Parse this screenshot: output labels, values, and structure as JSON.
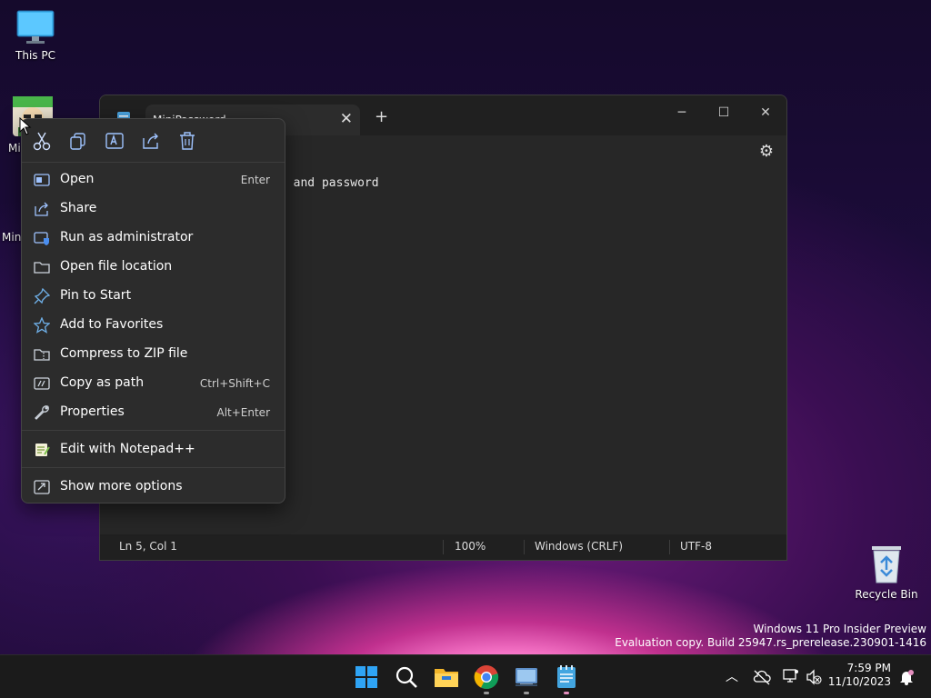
{
  "desktop": {
    "this_pc_label": "This PC",
    "mini_label_top": "Mi",
    "mini_label_bottom": "Min",
    "recycle_bin_label": "Recycle Bin"
  },
  "notepad": {
    "tab_title": "MiniPassword",
    "editor_visible_text": "t and password",
    "status": {
      "position": "Ln 5, Col 1",
      "zoom": "100%",
      "line_ending": "Windows (CRLF)",
      "encoding": "UTF-8"
    }
  },
  "context_menu": {
    "quick_actions": [
      "cut-icon",
      "copy-icon",
      "rename-icon",
      "share-icon",
      "delete-icon"
    ],
    "items": [
      {
        "label": "Open",
        "shortcut": "Enter",
        "icon": "open-icon"
      },
      {
        "label": "Share",
        "shortcut": "",
        "icon": "share-icon"
      },
      {
        "label": "Run as administrator",
        "shortcut": "",
        "icon": "shield-icon"
      },
      {
        "label": "Open file location",
        "shortcut": "",
        "icon": "folder-icon"
      },
      {
        "label": "Pin to Start",
        "shortcut": "",
        "icon": "pin-icon"
      },
      {
        "label": "Add to Favorites",
        "shortcut": "",
        "icon": "star-icon"
      },
      {
        "label": "Compress to ZIP file",
        "shortcut": "",
        "icon": "zip-icon"
      },
      {
        "label": "Copy as path",
        "shortcut": "Ctrl+Shift+C",
        "icon": "copy-path-icon"
      },
      {
        "label": "Properties",
        "shortcut": "Alt+Enter",
        "icon": "wrench-icon"
      }
    ],
    "notepadpp_label": "Edit with Notepad++",
    "more_options_label": "Show more options"
  },
  "watermark": {
    "line1": "Windows 11 Pro Insider Preview",
    "line2": "Evaluation copy. Build 25947.rs_prerelease.230901-1416"
  },
  "taskbar": {
    "time": "7:59 PM",
    "date": "11/10/2023",
    "pinned": [
      "windows-start-icon",
      "search-icon",
      "file-explorer-icon",
      "chrome-icon",
      "remote-desktop-icon",
      "notepad-icon"
    ]
  },
  "colors": {
    "accent": "#60a5fa",
    "menu_bg": "#2c2c2c",
    "window_bg": "#272727",
    "taskbar_bg": "#1b1b1b"
  }
}
